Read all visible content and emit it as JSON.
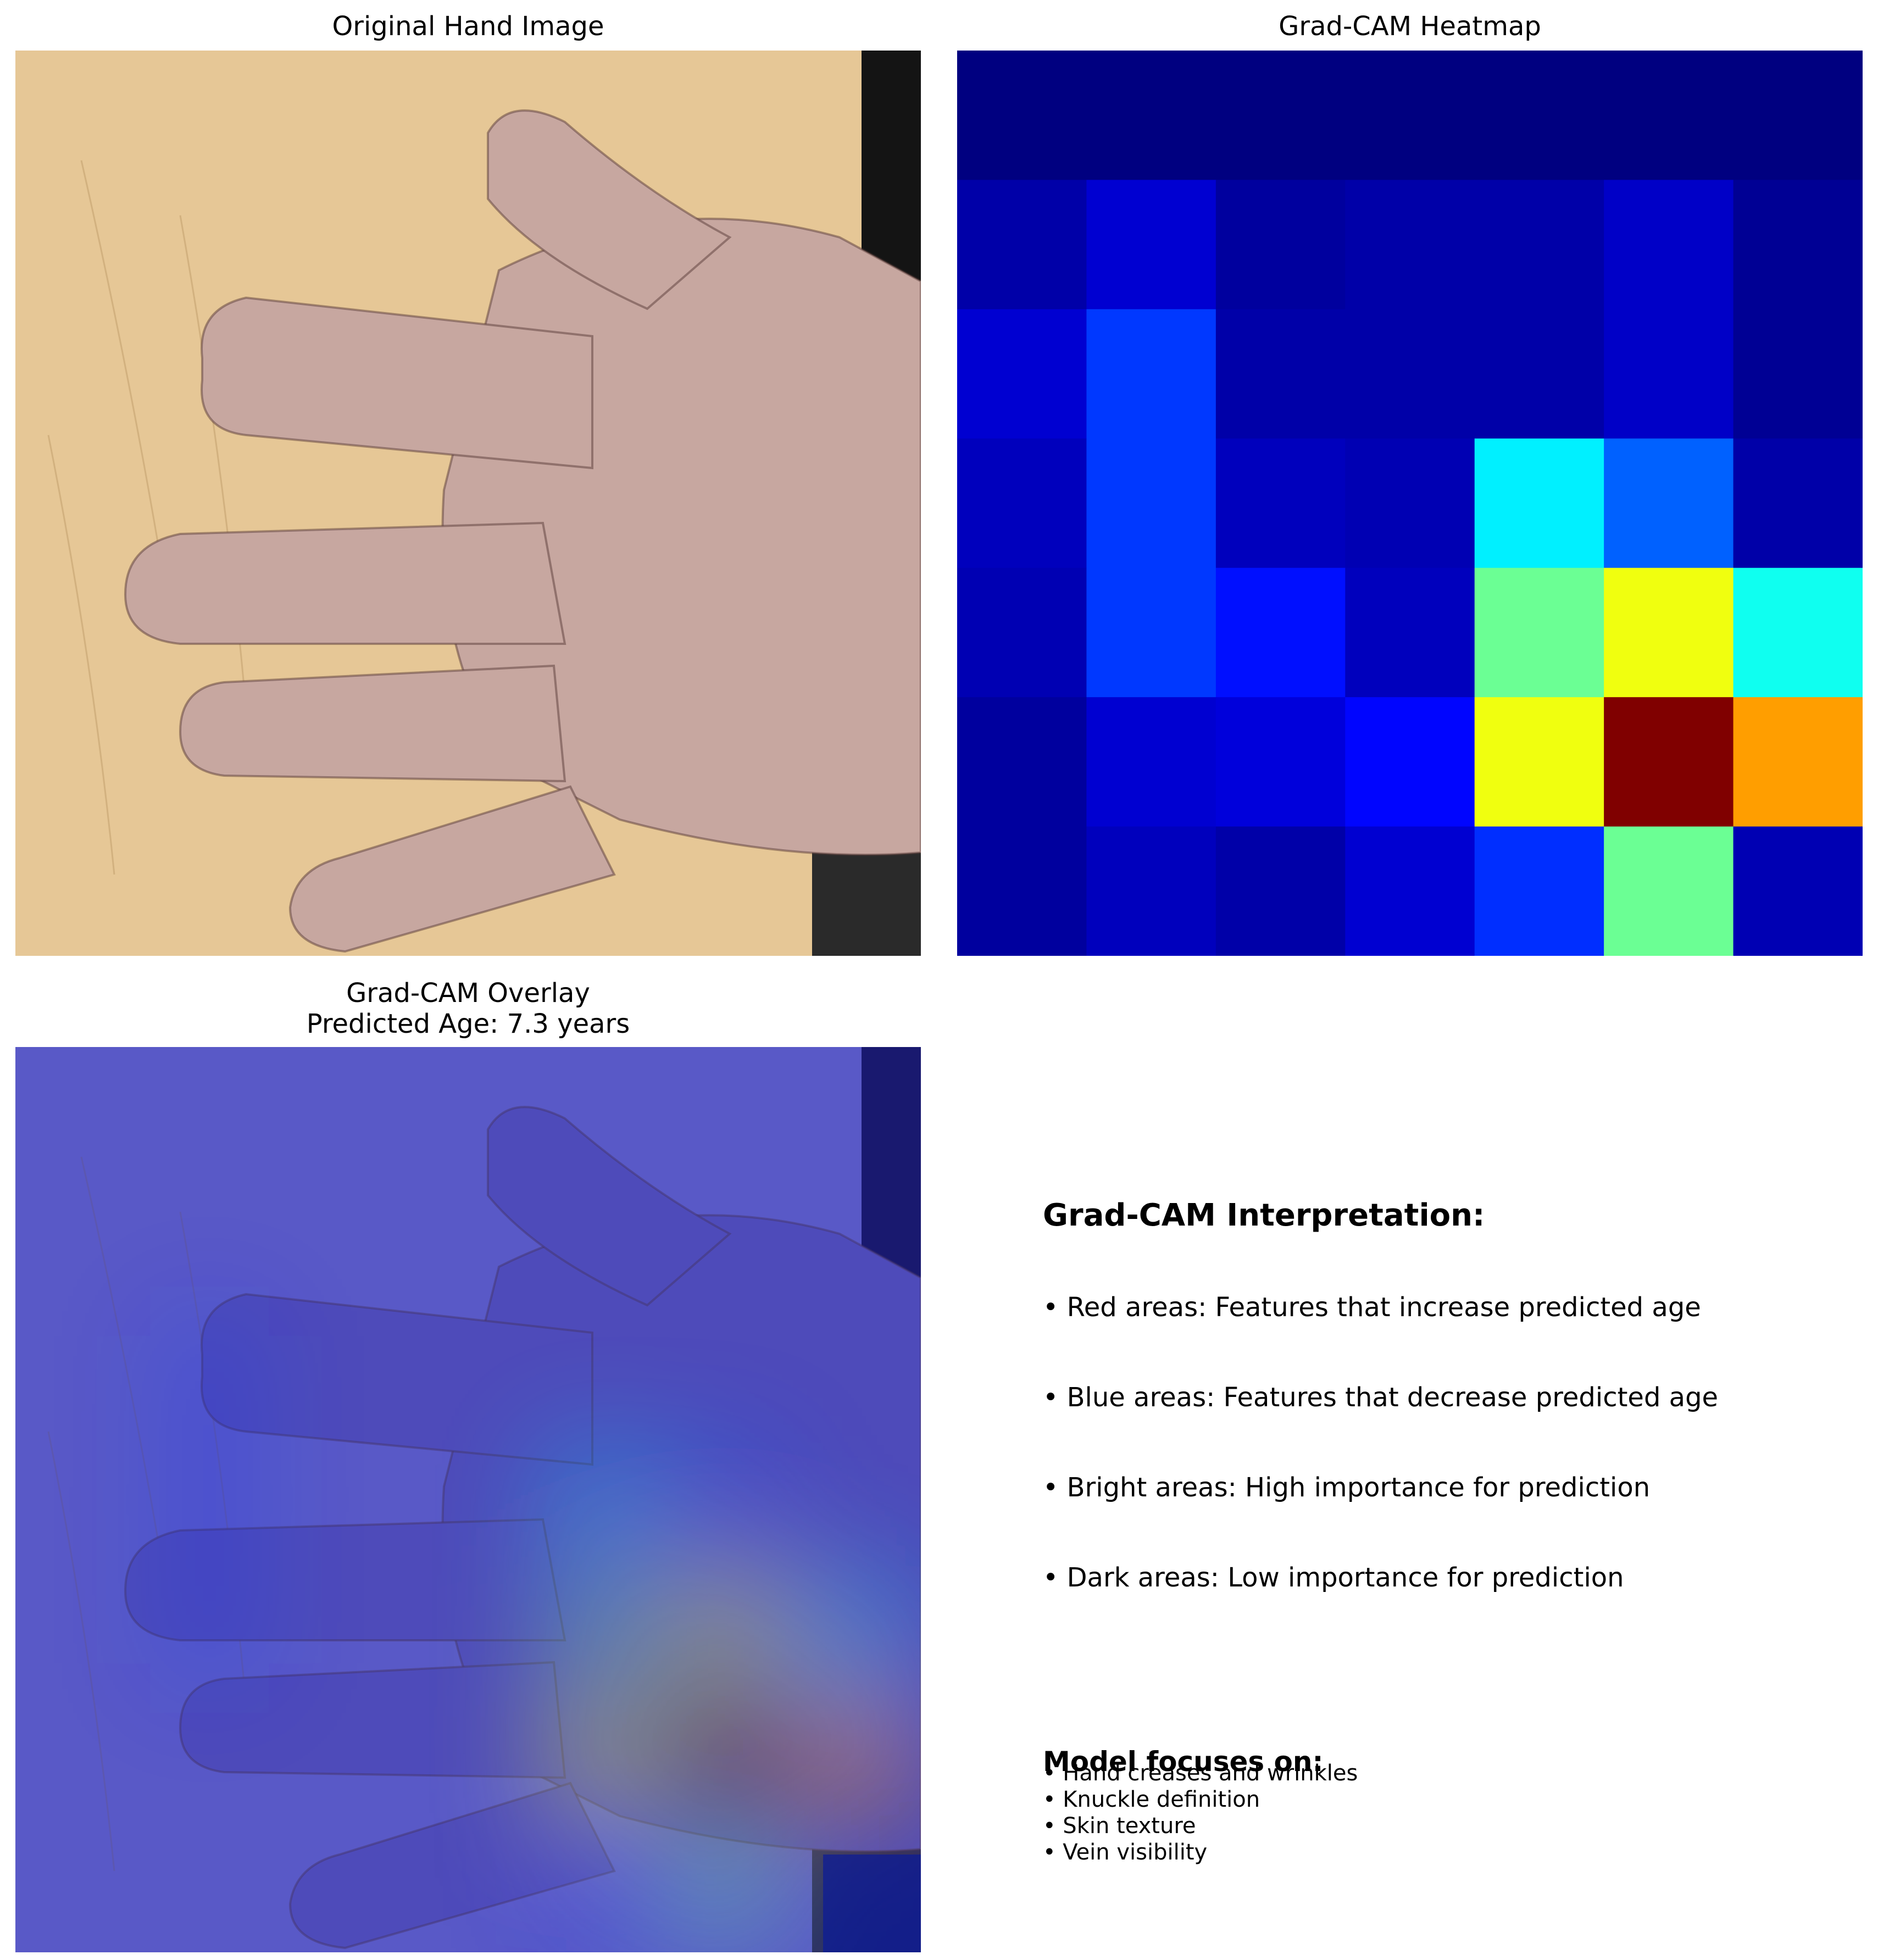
{
  "panels": {
    "original": {
      "title": "Original Hand Image"
    },
    "heatmap": {
      "title": "Grad-CAM Heatmap"
    },
    "overlay": {
      "title_line1": "Grad-CAM Overlay",
      "title_line2": "Predicted Age: 7.3 years"
    }
  },
  "interpretation": {
    "title": "Grad-CAM Interpretation:",
    "items": [
      "• Red areas: Features that increase predicted age",
      "• Blue areas: Features that decrease predicted age",
      "• Bright areas: High importance for prediction",
      "• Dark areas: Low importance for prediction"
    ]
  },
  "focus": {
    "title": "Model focuses on:",
    "items": [
      "• Hand creases and wrinkles",
      "• Knuckle definition",
      "• Skin texture",
      "• Vein visibility"
    ]
  },
  "colors": {
    "wood": "#e6c796",
    "skin": "#c7a7a0",
    "dark_edge": "#141414",
    "overlay_tint": "#2c2ca8"
  },
  "chart_data": {
    "type": "heatmap",
    "colormap": "jet",
    "rows": 7,
    "cols": 7,
    "values": [
      [
        0.0,
        0.0,
        0.0,
        0.0,
        0.0,
        0.0,
        0.0
      ],
      [
        0.04,
        0.08,
        0.03,
        0.04,
        0.04,
        0.07,
        0.02
      ],
      [
        0.08,
        0.18,
        0.04,
        0.04,
        0.04,
        0.07,
        0.02
      ],
      [
        0.06,
        0.18,
        0.06,
        0.05,
        0.36,
        0.22,
        0.04
      ],
      [
        0.05,
        0.18,
        0.14,
        0.06,
        0.48,
        0.61,
        0.39
      ],
      [
        0.03,
        0.08,
        0.09,
        0.13,
        0.61,
        1.0,
        0.72
      ],
      [
        0.03,
        0.06,
        0.04,
        0.08,
        0.17,
        0.48,
        0.05
      ]
    ]
  }
}
